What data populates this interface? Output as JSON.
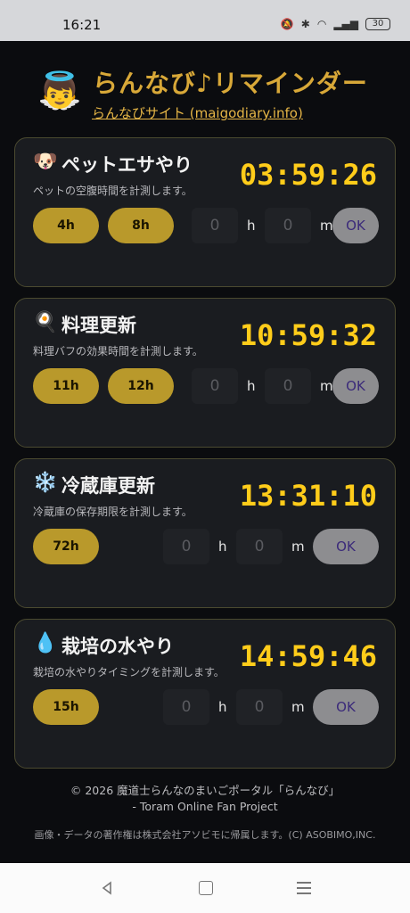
{
  "status": {
    "time": "16:21",
    "battery": "30"
  },
  "header": {
    "title": "らんなび♪リマインダー",
    "link": "らんなびサイト (maigodiary.info)"
  },
  "cards": [
    {
      "emoji": "🐶",
      "name": "ペットエサやり",
      "desc": "ペットの空腹時間を計測します。",
      "timer": "03:59:26",
      "presets": [
        "4h",
        "8h"
      ]
    },
    {
      "emoji": "🍳",
      "name": "料理更新",
      "desc": "料理バフの効果時間を計測します。",
      "timer": "10:59:32",
      "presets": [
        "11h",
        "12h"
      ]
    },
    {
      "emoji": "❄️",
      "name": "冷蔵庫更新",
      "desc": "冷蔵庫の保存期限を計測します。",
      "timer": "13:31:10",
      "presets": [
        "72h"
      ]
    },
    {
      "emoji": "💧",
      "name": "栽培の水やり",
      "desc": "栽培の水やりタイミングを計測します。",
      "timer": "14:59:46",
      "presets": [
        "15h"
      ]
    }
  ],
  "input": {
    "hours_placeholder": "0",
    "minutes_placeholder": "0",
    "h_unit": "h",
    "m_unit": "m",
    "ok_label": "OK"
  },
  "footer": {
    "line1": "© 2026 魔道士らんなのまいごポータル「らんなび」",
    "line2": "- Toram Online Fan Project",
    "line3": "画像・データの著作権は株式会社アソビモに帰属します。(C) ASOBIMO,INC."
  }
}
